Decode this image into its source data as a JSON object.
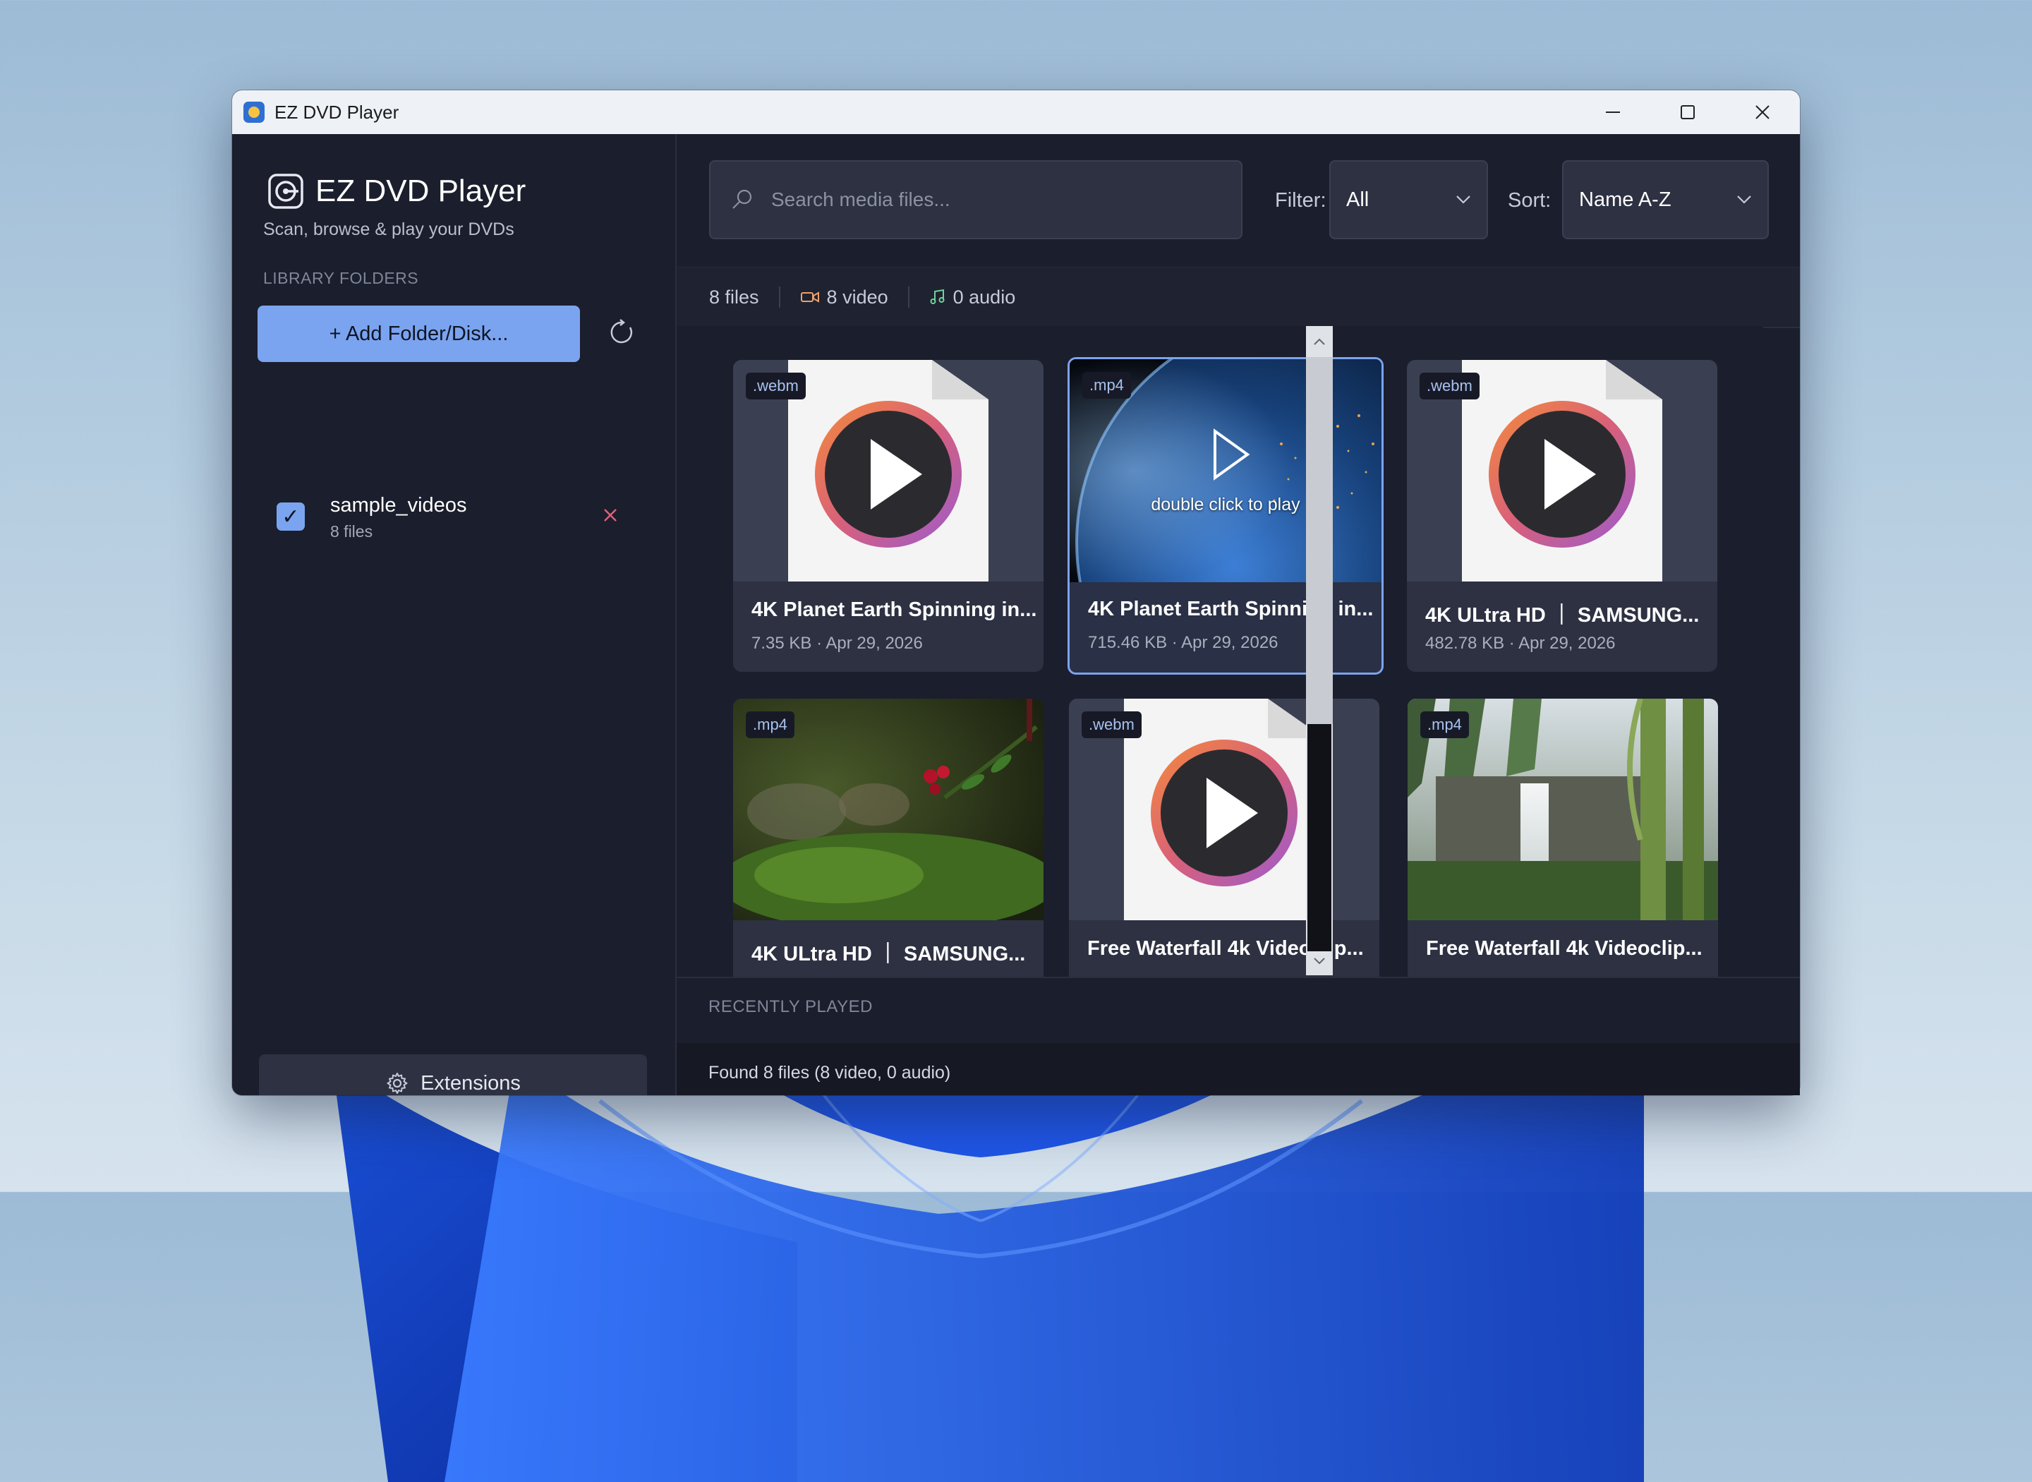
{
  "window": {
    "title": "EZ DVD Player"
  },
  "sidebar": {
    "app_name": "EZ DVD Player",
    "tagline": "Scan, browse & play your DVDs",
    "section_heading": "LIBRARY FOLDERS",
    "add_button": "+ Add Folder/Disk...",
    "folders": [
      {
        "name": "sample_videos",
        "count": "8 files",
        "checked": true
      }
    ],
    "extensions_button": "Extensions"
  },
  "toolbar": {
    "search_placeholder": "Search media files...",
    "filter_label": "Filter:",
    "filter_value": "All",
    "sort_label": "Sort:",
    "sort_value": "Name A-Z"
  },
  "stats": {
    "files": "8 files",
    "video": "8 video",
    "audio": "0 audio"
  },
  "media": [
    {
      "ext": ".webm",
      "title": "4K Planet Earth Spinning in...",
      "meta": "7.35 KB · Apr 29, 2026",
      "thumb": "file-icon"
    },
    {
      "ext": ".mp4",
      "title": "4K Planet Earth Spinning in...",
      "meta": "715.46 KB · Apr 29, 2026",
      "thumb": "earth",
      "hover": "double click to play",
      "selected": true
    },
    {
      "ext": ".webm",
      "title": "4K ULtra HD ｜ SAMSUNG...",
      "meta": "482.78 KB · Apr 29, 2026",
      "thumb": "file-icon"
    },
    {
      "ext": ".mp4",
      "title": "4K ULtra HD ｜ SAMSUNG...",
      "meta": "",
      "thumb": "forest-berries"
    },
    {
      "ext": ".webm",
      "title": "Free Waterfall 4k Videoclip...",
      "meta": "",
      "thumb": "file-icon"
    },
    {
      "ext": ".mp4",
      "title": "Free Waterfall 4k Videoclip...",
      "meta": "",
      "thumb": "waterfall"
    }
  ],
  "recently_played": {
    "heading": "RECENTLY PLAYED"
  },
  "status": "Found 8 files (8 video, 0 audio)",
  "colors": {
    "accent": "#7aa4ef",
    "background": "#1b1e2c",
    "card": "#2d3142"
  }
}
